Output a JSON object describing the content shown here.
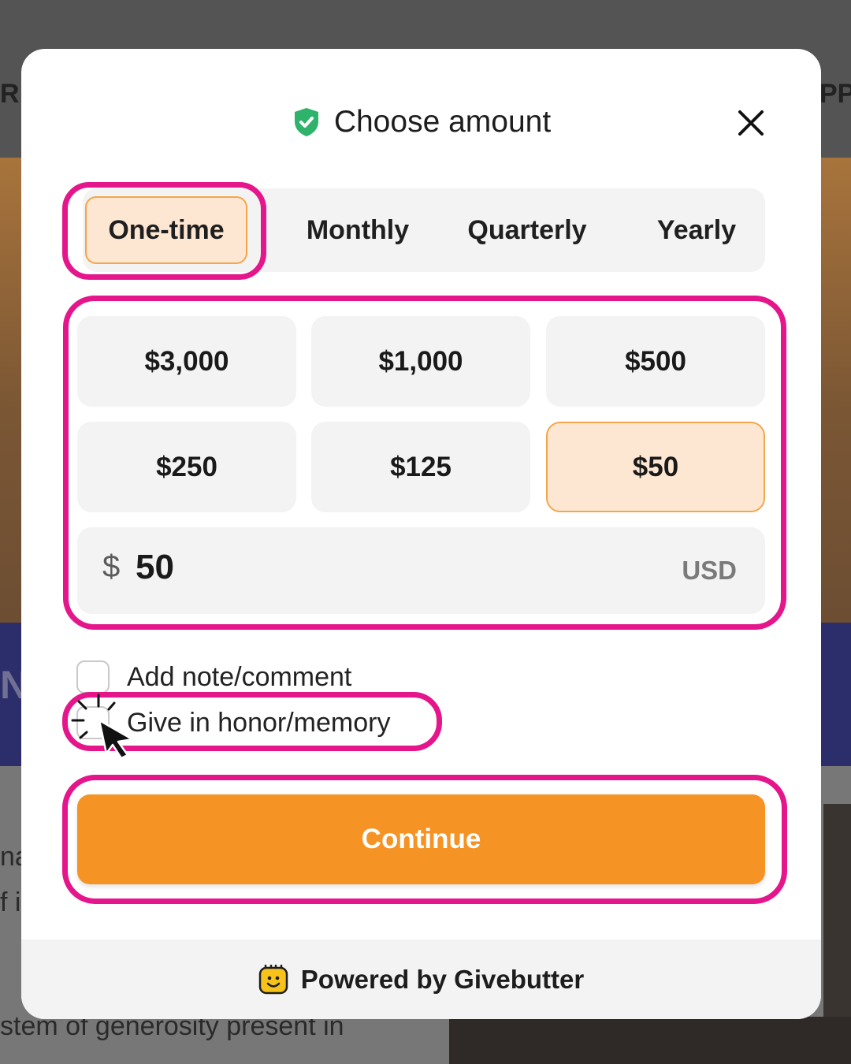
{
  "background": {
    "nav_left_fragment": "R",
    "nav_right_fragment": "PP",
    "band_fragment": "N",
    "body_lines": [
      "na",
      "f i",
      "stem of generosity present in"
    ]
  },
  "modal": {
    "title": "Choose amount",
    "icons": {
      "title_icon": "shield-check-icon",
      "close": "close-icon",
      "footer_logo": "givebutter-logo-icon"
    },
    "frequency_tabs": [
      {
        "label": "One-time",
        "active": true
      },
      {
        "label": "Monthly",
        "active": false
      },
      {
        "label": "Quarterly",
        "active": false
      },
      {
        "label": "Yearly",
        "active": false
      }
    ],
    "amounts": [
      {
        "label": "$3,000",
        "selected": false
      },
      {
        "label": "$1,000",
        "selected": false
      },
      {
        "label": "$500",
        "selected": false
      },
      {
        "label": "$250",
        "selected": false
      },
      {
        "label": "$125",
        "selected": false
      },
      {
        "label": "$50",
        "selected": true
      }
    ],
    "amount_input": {
      "currency_symbol": "$",
      "value": "50",
      "currency_code": "USD"
    },
    "options": [
      {
        "label": "Add note/comment",
        "checked": false
      },
      {
        "label": "Give in honor/memory",
        "checked": false
      }
    ],
    "continue_label": "Continue",
    "footer_text": "Powered by Givebutter"
  },
  "colors": {
    "accent_orange": "#f59424",
    "selected_fill": "#fde7d2",
    "highlight_magenta": "#e5168b",
    "shield_green": "#2fb36b"
  }
}
